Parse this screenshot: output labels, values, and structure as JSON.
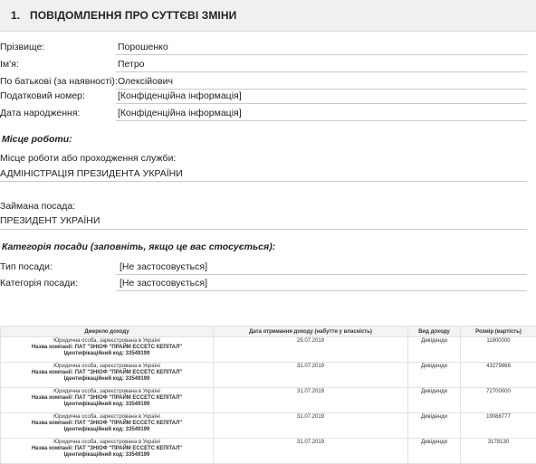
{
  "section": {
    "number": "1.",
    "title": "Повідомлення про суттєві зміни"
  },
  "person": {
    "fields": [
      {
        "label": "Прізвище:",
        "value": "Порошенко"
      },
      {
        "label": "Ім'я:",
        "value": "Петро"
      },
      {
        "label": "По батькові (за наявності):",
        "value": "Олексійович"
      },
      {
        "label": "Податковий номер:",
        "value": "[Конфіденційна інформація]"
      },
      {
        "label": "Дата народження:",
        "value": "[Конфіденційна інформація]"
      }
    ]
  },
  "work": {
    "heading": "Місце роботи:",
    "place_label": "Місце роботи або проходження служби:",
    "place_value": "АДМІНІСТРАЦІЯ ПРЕЗИДЕНТА УКРАЇНИ",
    "position_label": "Займана посада:",
    "position_value": "ПРЕЗИДЕНТ УКРАЇНИ"
  },
  "category": {
    "heading": "Категорія посади (заповніть, якщо це вас стосується):",
    "fields": [
      {
        "label": "Тип посади:",
        "value": "[Не застосовується]"
      },
      {
        "label": "Категорія посади:",
        "value": "[Не застосовується]"
      }
    ]
  },
  "income_table": {
    "headers": [
      "Джерело доходу",
      "Дата отримання доходу (набуття у власність)",
      "Вид доходу",
      "Розмір (вартість)"
    ],
    "rows": [
      {
        "source_line1": "Юридична особа, зареєстрована в Україні",
        "source_line2": "Назва компанії: ПАТ \"ЗНІОФ \"ПРАЙМ ЕССЕТС КЕПІТАЛ\"",
        "source_line3": "Ідентифікаційний код: 33549199",
        "date": "29.07.2019",
        "type": "Дивіденди",
        "amount": "11800000"
      },
      {
        "source_line1": "Юридична особа, зареєстрована в Україні",
        "source_line2": "Назва компанії: ПАТ \"ЗНІОФ \"ПРАЙМ ЕССЕТС КЕПІТАЛ\"",
        "source_line3": "Ідентифікаційний код: 33549199",
        "date": "31.07.2019",
        "type": "Дивіденди",
        "amount": "43279868"
      },
      {
        "source_line1": "Юридична особа, зареєстрована в Україні",
        "source_line2": "Назва компанії: ПАТ \"ЗНІОФ \"ПРАЙМ ЕССЕТС КЕПІТАЛ\"",
        "source_line3": "Ідентифікаційний код: 33549199",
        "date": "31.07.2019",
        "type": "Дивіденди",
        "amount": "72700000"
      },
      {
        "source_line1": "Юридична особа, зареєстрована в Україні",
        "source_line2": "Назва компанії: ПАТ \"ЗНІОФ \"ПРАЙМ ЕССЕТС КЕПІТАЛ\"",
        "source_line3": "Ідентифікаційний код: 33549199",
        "date": "31.07.2019",
        "type": "Дивіденди",
        "amount": "19088777"
      },
      {
        "source_line1": "Юридична особа, зареєстрована в Україні",
        "source_line2": "Назва компанії: ПАТ \"ЗНІОФ \"ПРАЙМ ЕССЕТС КЕПІТАЛ\"",
        "source_line3": "Ідентифікаційний код: 33549199",
        "date": "31.07.2019",
        "type": "Дивіденди",
        "amount": "3178130"
      }
    ]
  }
}
